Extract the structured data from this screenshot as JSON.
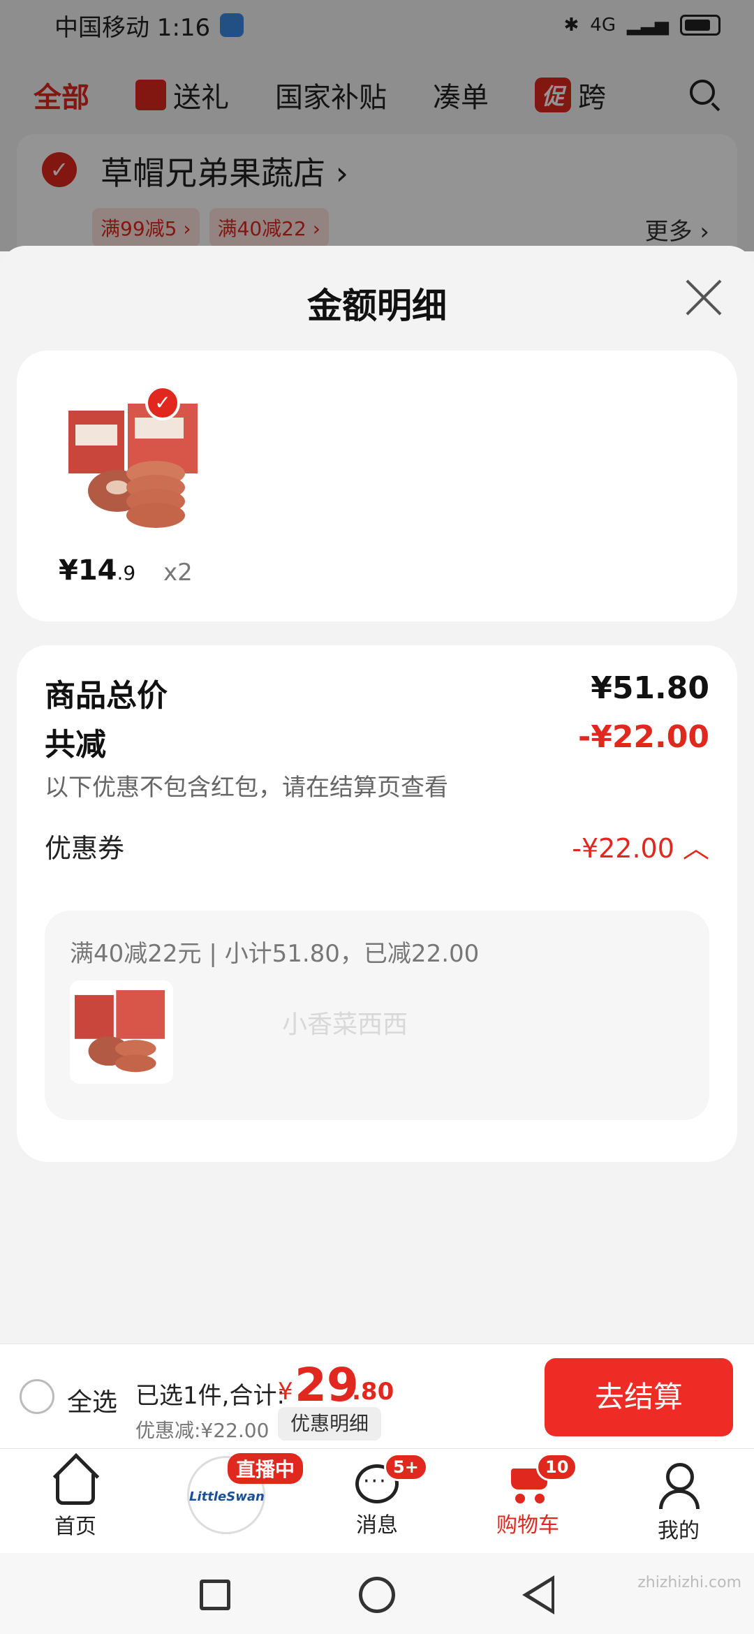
{
  "status_bar": {
    "carrier_time": "中国移动 1:16",
    "network": "4G"
  },
  "top_tabs": [
    {
      "label": "全部",
      "active": true
    },
    {
      "label": "送礼",
      "active": false
    },
    {
      "label": "国家补贴",
      "active": false
    },
    {
      "label": "凑单",
      "active": false
    },
    {
      "label": "跨",
      "badge": "促",
      "active": false
    }
  ],
  "store": {
    "name": "草帽兄弟果蔬店 ›",
    "tags": [
      "满99减5 ›",
      "满40减22 ›"
    ],
    "more": "更多 ›"
  },
  "sheet": {
    "title": "金额明细",
    "item": {
      "price_int": "¥14",
      "price_dec": ".9",
      "qty": "x2"
    },
    "goods_total_label": "商品总价",
    "goods_total_value": "¥51.80",
    "total_discount_label": "共减",
    "total_discount_value": "-¥22.00",
    "note": "以下优惠不包含红包，请在结算页查看",
    "coupon_label": "优惠券",
    "coupon_value": "-¥22.00 ︿",
    "coupon_desc": "满40减22元 | 小计51.80，已减22.00",
    "watermark": "小香菜西西"
  },
  "checkout": {
    "select_all": "全选",
    "selected": "已选1件,合计:",
    "currency": "¥",
    "total_int": "29",
    "total_dec": ".80",
    "discount_text": "优惠减:¥22.00",
    "discount_detail": "优惠明细",
    "button": "去结算"
  },
  "tab_bar": {
    "home": "首页",
    "live_badge": "直播中",
    "live_brand": "LittleSwan",
    "messages": "消息",
    "messages_badge": "5+",
    "cart": "购物车",
    "cart_badge": "10",
    "me": "我的"
  },
  "corner_mark": "zhizhizhi.com",
  "colors": {
    "accent": "#e0281e",
    "checkout_button": "#ef2b26"
  }
}
